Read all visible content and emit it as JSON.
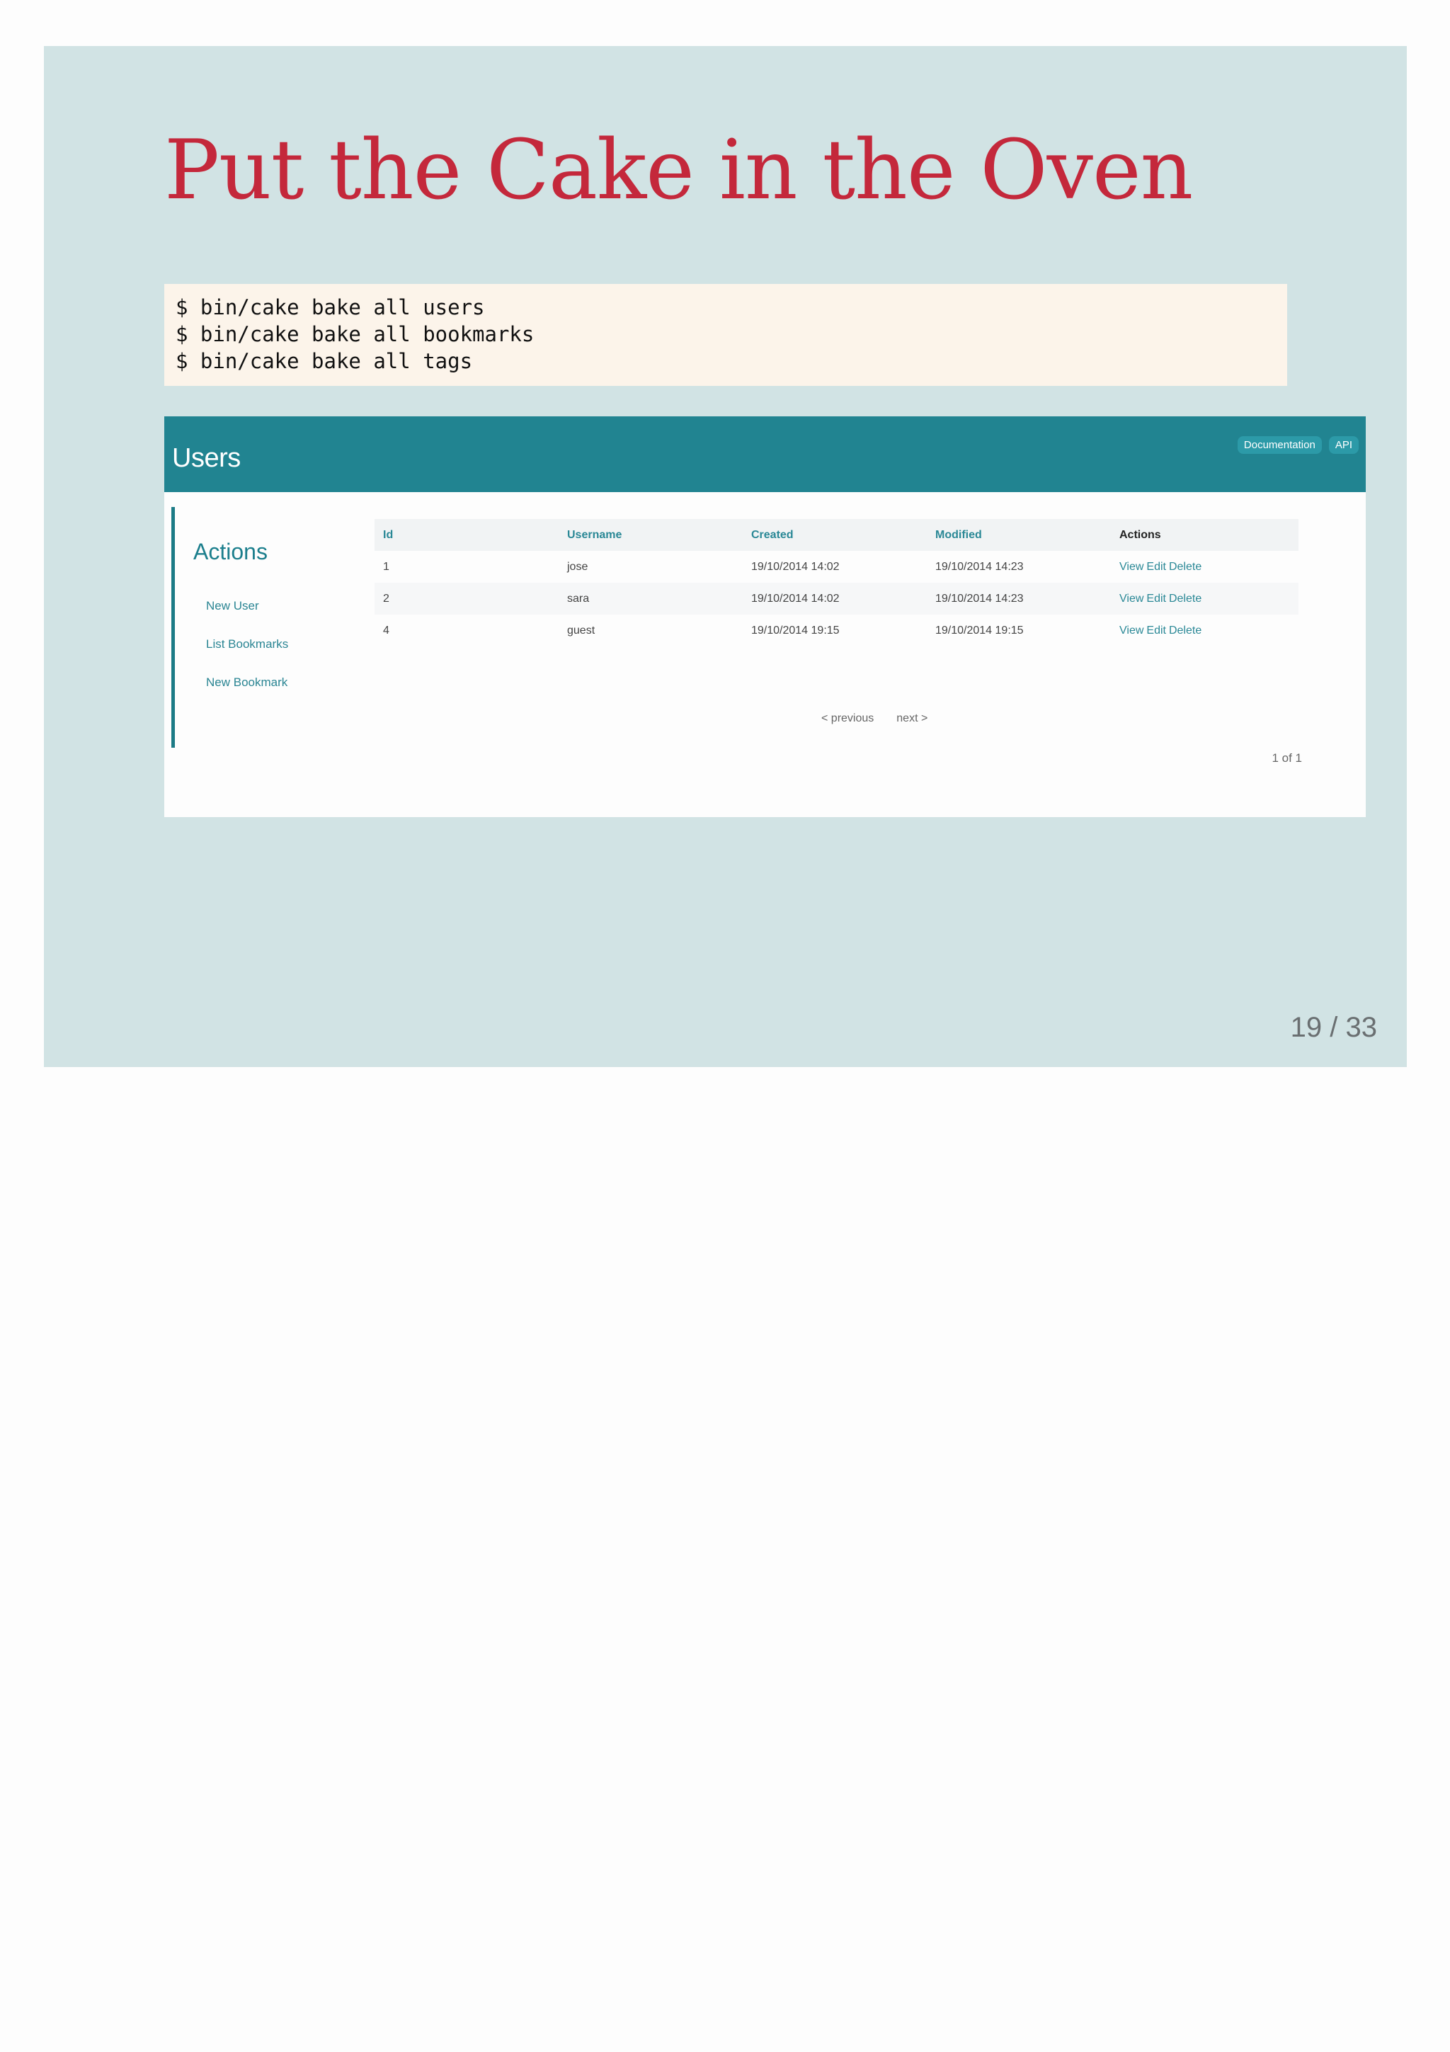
{
  "slide": {
    "title": "Put the Cake in the Oven",
    "page_number": "19 / 33"
  },
  "code": {
    "lines": [
      "$ bin/cake bake all users",
      "$ bin/cake bake all bookmarks",
      "$ bin/cake bake all tags"
    ]
  },
  "app": {
    "title": "Users",
    "header_links": [
      "Documentation",
      "API"
    ],
    "sidebar": {
      "heading": "Actions",
      "links": [
        "New User",
        "List Bookmarks",
        "New Bookmark"
      ]
    },
    "table": {
      "columns": [
        "Id",
        "Username",
        "Created",
        "Modified",
        "Actions"
      ],
      "rows": [
        {
          "id": "1",
          "username": "jose",
          "created": "19/10/2014 14:02",
          "modified": "19/10/2014 14:23"
        },
        {
          "id": "2",
          "username": "sara",
          "created": "19/10/2014 14:02",
          "modified": "19/10/2014 14:23"
        },
        {
          "id": "4",
          "username": "guest",
          "created": "19/10/2014 19:15",
          "modified": "19/10/2014 19:15"
        }
      ],
      "row_actions": [
        "View",
        "Edit",
        "Delete"
      ]
    },
    "pager": {
      "previous": "< previous",
      "next": "next >",
      "counter": "1 of 1"
    }
  },
  "colors": {
    "slide_background": "#d1e3e4",
    "title": "#c4283b",
    "code_background": "#fcf4ea",
    "header": "#218491",
    "accent": "#2a8896"
  }
}
